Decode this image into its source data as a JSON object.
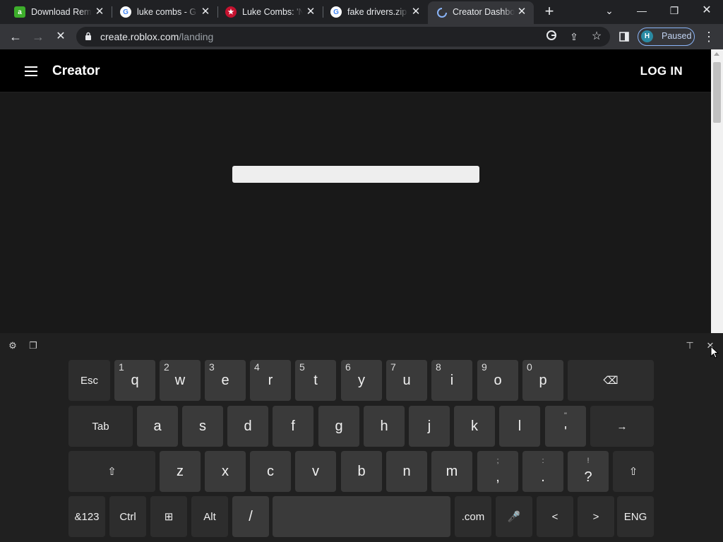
{
  "tabs": [
    {
      "title": "Download Remo",
      "favicon": "a",
      "favicon_color": "#3dae2b"
    },
    {
      "title": "luke combs - G",
      "favicon": "G",
      "favicon_color": "#4285f4"
    },
    {
      "title": "Luke Combs: 'N",
      "favicon": "★",
      "favicon_color": "#c4122f"
    },
    {
      "title": "fake drivers.zip",
      "favicon": "G",
      "favicon_color": "#4285f4"
    },
    {
      "title": "Creator Dashbo",
      "favicon": "loading",
      "favicon_color": "#8ab4f8",
      "active": true
    }
  ],
  "new_tab_label": "+",
  "window_controls": {
    "tab_search": "⌄",
    "minimize": "—",
    "restore": "❐",
    "close": "✕"
  },
  "toolbar": {
    "back": "←",
    "forward": "→",
    "stop": "✕",
    "url_domain": "create.roblox.com",
    "url_path": "/landing",
    "profile_initial": "H",
    "profile_status": "Paused",
    "menu": "⋮"
  },
  "site": {
    "brand": "Creator",
    "login": "LOG IN"
  },
  "keyboard": {
    "row1": [
      {
        "label": "Esc",
        "fn": true
      },
      {
        "label": "q",
        "num": "1"
      },
      {
        "label": "w",
        "num": "2"
      },
      {
        "label": "e",
        "num": "3"
      },
      {
        "label": "r",
        "num": "4"
      },
      {
        "label": "t",
        "num": "5"
      },
      {
        "label": "y",
        "num": "6"
      },
      {
        "label": "u",
        "num": "7"
      },
      {
        "label": "i",
        "num": "8"
      },
      {
        "label": "o",
        "num": "9"
      },
      {
        "label": "p",
        "num": "0"
      },
      {
        "label": "⌫",
        "fn": true
      }
    ],
    "row2": [
      {
        "label": "Tab",
        "fn": true
      },
      {
        "label": "a"
      },
      {
        "label": "s"
      },
      {
        "label": "d"
      },
      {
        "label": "f"
      },
      {
        "label": "g"
      },
      {
        "label": "h"
      },
      {
        "label": "j"
      },
      {
        "label": "k"
      },
      {
        "label": "l"
      },
      {
        "label": "'",
        "alt": "\""
      },
      {
        "label": "→",
        "fn": true
      }
    ],
    "row3": [
      {
        "label": "⇧",
        "fn": true
      },
      {
        "label": "z"
      },
      {
        "label": "x"
      },
      {
        "label": "c"
      },
      {
        "label": "v"
      },
      {
        "label": "b"
      },
      {
        "label": "n"
      },
      {
        "label": "m"
      },
      {
        "label": ",",
        "alt": ";"
      },
      {
        "label": ".",
        "alt": ":"
      },
      {
        "label": "?",
        "alt": "!"
      },
      {
        "label": "⇧",
        "fn": true
      }
    ],
    "row4": [
      {
        "label": "&123",
        "fn": true
      },
      {
        "label": "Ctrl",
        "fn": true
      },
      {
        "label": "⊞",
        "fn": true
      },
      {
        "label": "Alt",
        "fn": true
      },
      {
        "label": "/"
      },
      {
        "label": ""
      },
      {
        "label": ".com",
        "fn": true
      },
      {
        "label": "🎤",
        "fn": true
      },
      {
        "label": "<",
        "fn": true
      },
      {
        "label": ">",
        "fn": true
      },
      {
        "label": "ENG",
        "fn": true
      }
    ]
  }
}
